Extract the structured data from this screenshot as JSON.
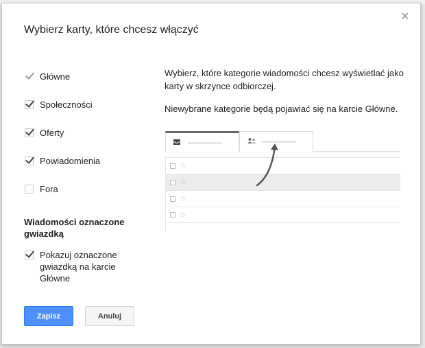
{
  "dialog": {
    "title": "Wybierz karty, które chcesz włączyć",
    "close_glyph": "×"
  },
  "categories": [
    {
      "label": "Główne",
      "checked": true,
      "disabled": true
    },
    {
      "label": "Społeczności",
      "checked": true,
      "disabled": false
    },
    {
      "label": "Oferty",
      "checked": true,
      "disabled": false
    },
    {
      "label": "Powiadomienia",
      "checked": true,
      "disabled": false
    },
    {
      "label": "Fora",
      "checked": false,
      "disabled": false
    }
  ],
  "starred": {
    "section_title": "Wiadomości oznaczone gwiazdką",
    "option_label": "Pokazuj oznaczone gwiazdką na karcie Główne",
    "checked": true
  },
  "description": {
    "line1": "Wybierz, które kategorie wiadomości chcesz wyświetlać jako karty w skrzynce odbiorczej.",
    "line2": "Niewybrane kategorie będą pojawiać się na karcie Główne."
  },
  "preview": {
    "tabs": [
      {
        "icon": "inbox-icon",
        "active": true
      },
      {
        "icon": "people-icon",
        "active": false
      }
    ],
    "rows": [
      {
        "shaded": false
      },
      {
        "shaded": true
      },
      {
        "shaded": false
      },
      {
        "shaded": false
      }
    ],
    "star_glyph": "☆"
  },
  "buttons": {
    "save": "Zapisz",
    "cancel": "Anuluj"
  },
  "colors": {
    "primary_button": "#4d90fe",
    "active_tab_border": "#666666"
  }
}
